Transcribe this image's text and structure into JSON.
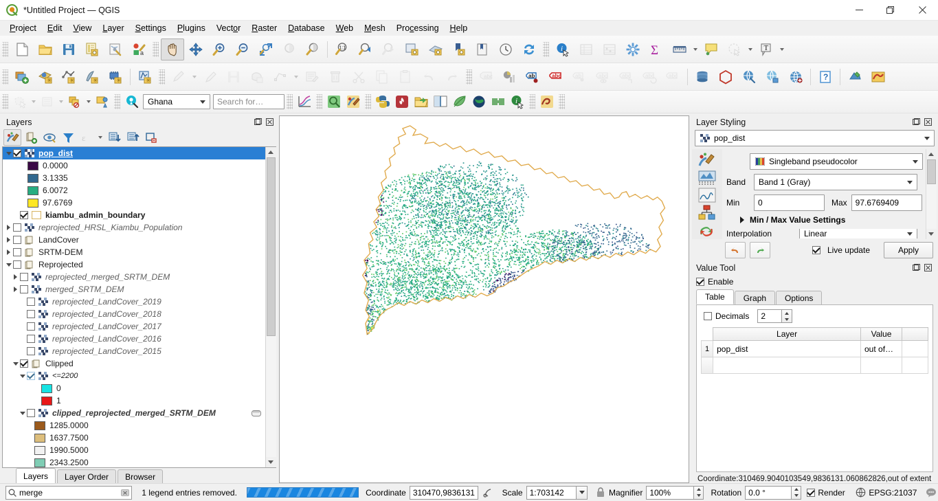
{
  "window": {
    "title": "*Untitled Project — QGIS",
    "app_icon": "qgis-logo-icon",
    "minimize_label": "—",
    "maximize_label": "❐",
    "close_label": "✕"
  },
  "menubar": {
    "items": [
      {
        "label": "Project",
        "accel": "P"
      },
      {
        "label": "Edit",
        "accel": "E"
      },
      {
        "label": "View",
        "accel": "V"
      },
      {
        "label": "Layer",
        "accel": "L"
      },
      {
        "label": "Settings",
        "accel": "S"
      },
      {
        "label": "Plugins",
        "accel": "P"
      },
      {
        "label": "Vector",
        "accel": "o"
      },
      {
        "label": "Raster",
        "accel": "R"
      },
      {
        "label": "Database",
        "accel": "D"
      },
      {
        "label": "Web",
        "accel": "W"
      },
      {
        "label": "Mesh",
        "accel": "M"
      },
      {
        "label": "Processing",
        "accel": "c"
      },
      {
        "label": "Help",
        "accel": "H"
      }
    ]
  },
  "toolbars": {
    "project": [
      {
        "name": "new-project-icon",
        "title": "New Project"
      },
      {
        "name": "open-project-icon",
        "title": "Open Project"
      },
      {
        "name": "save-project-icon",
        "title": "Save Project"
      },
      {
        "name": "save-project-as-icon",
        "title": "Save Project As"
      },
      {
        "name": "new-print-layout-icon",
        "title": "New Print Layout"
      },
      {
        "name": "style-manager-icon",
        "title": "Style Manager"
      }
    ],
    "navigation": [
      {
        "name": "pan-map-icon",
        "title": "Pan Map",
        "active": true
      },
      {
        "name": "pan-to-selection-icon",
        "title": "Pan Map to Selection"
      },
      {
        "name": "zoom-in-icon",
        "title": "Zoom In"
      },
      {
        "name": "zoom-out-icon",
        "title": "Zoom Out"
      },
      {
        "name": "zoom-full-icon",
        "title": "Zoom Full"
      },
      {
        "name": "zoom-to-selection-icon",
        "title": "Zoom To Selection",
        "dim": true
      },
      {
        "name": "zoom-to-layer-icon",
        "title": "Zoom To Layer"
      },
      {
        "name": "zoom-native-icon",
        "title": "Zoom To Native Resolution"
      },
      {
        "name": "zoom-last-icon",
        "title": "Zoom Last"
      },
      {
        "name": "zoom-next-icon",
        "title": "Zoom Next",
        "dim": true
      },
      {
        "name": "refresh-layer-icon",
        "title": "Refresh Layer"
      },
      {
        "name": "new-map-view-icon",
        "title": "New Map View"
      },
      {
        "name": "new-3d-map-view-icon",
        "title": "New 3D Map View"
      },
      {
        "name": "new-bookmark-icon",
        "title": "New Spatial Bookmark"
      },
      {
        "name": "show-bookmarks-icon",
        "title": "Show Bookmarks"
      },
      {
        "name": "temporal-controller-icon",
        "title": "Temporal Controller Panel"
      },
      {
        "name": "refresh-map-icon",
        "title": "Refresh"
      }
    ],
    "attributes": [
      {
        "name": "identify-features-icon",
        "title": "Identify Features"
      },
      {
        "name": "open-attribute-table-icon",
        "title": "Open Attribute Table",
        "dim": true
      },
      {
        "name": "field-calculator-icon",
        "title": "Field Calculator",
        "dim": true
      },
      {
        "name": "processing-toolbox-icon",
        "title": "Processing Toolbox"
      },
      {
        "name": "statistical-summary-icon",
        "title": "Statistical Summary"
      },
      {
        "name": "measure-line-icon",
        "title": "Measure Line"
      },
      {
        "name": "map-tips-icon",
        "title": "Show Map Tips"
      },
      {
        "name": "select-features-icon",
        "title": "Select Features",
        "dim": true
      },
      {
        "name": "text-annotation-icon",
        "title": "Text Annotation"
      }
    ],
    "data_source": [
      {
        "name": "add-layer-icon",
        "title": "Open Data Source Manager"
      },
      {
        "name": "add-vector-layer-icon",
        "title": "Add Vector Layer"
      },
      {
        "name": "add-raster-layer-icon",
        "title": "Add Raster Layer"
      },
      {
        "name": "add-delimited-text-icon",
        "title": "Add Delimited Text Layer"
      },
      {
        "name": "add-mesh-layer-icon",
        "title": "Add Mesh Layer"
      },
      {
        "name": "add-virtual-layer-icon",
        "title": "Add Virtual Layer"
      }
    ],
    "digitizing": [
      {
        "name": "current-edits-icon",
        "title": "Current Edits",
        "dim": true
      },
      {
        "name": "toggle-editing-icon",
        "title": "Toggle Editing",
        "dim": true
      },
      {
        "name": "save-layer-edits-icon",
        "title": "Save Layer Edits",
        "dim": true
      },
      {
        "name": "add-polygon-feature-icon",
        "title": "Add Polygon Feature",
        "dim": true
      },
      {
        "name": "vertex-tool-icon",
        "title": "Vertex Tool",
        "dim": true
      },
      {
        "name": "modify-attributes-icon",
        "title": "Modify Attributes of Features",
        "dim": true
      },
      {
        "name": "delete-selected-icon",
        "title": "Delete Selected",
        "dim": true
      },
      {
        "name": "cut-features-icon",
        "title": "Cut Features",
        "dim": true
      },
      {
        "name": "copy-features-icon",
        "title": "Copy Features",
        "dim": true
      },
      {
        "name": "paste-features-icon",
        "title": "Paste Features",
        "dim": true
      },
      {
        "name": "undo-icon",
        "title": "Undo",
        "dim": true
      },
      {
        "name": "redo-icon",
        "title": "Redo",
        "dim": true
      }
    ],
    "label": [
      {
        "name": "layer-labeling-icon",
        "title": "Layer Labeling Options",
        "dim": true
      },
      {
        "name": "layer-diagram-icon",
        "title": "Layer Diagram Options"
      },
      {
        "name": "highlight-pinned-labels-icon",
        "title": "Highlight Pinned Labels"
      },
      {
        "name": "toggle-unplaced-labels-icon",
        "title": "Toggle Display of Unplaced Labels"
      },
      {
        "name": "pin-labels-icon",
        "title": "Pin/Unpin Labels",
        "dim": true
      },
      {
        "name": "show-hide-labels-icon",
        "title": "Show/Hide Labels",
        "dim": true
      },
      {
        "name": "move-label-icon",
        "title": "Move Label",
        "dim": true
      },
      {
        "name": "rotate-label-icon",
        "title": "Rotate Label",
        "dim": true
      },
      {
        "name": "change-label-icon",
        "title": "Change Label",
        "dim": true
      }
    ],
    "database": [
      {
        "name": "db-manager-icon",
        "title": "DB Manager"
      },
      {
        "name": "geopackage-icon",
        "title": "Add GeoPackage Layer"
      },
      {
        "name": "metasearch-icon",
        "title": "MetaSearch"
      },
      {
        "name": "qgis-server-icon",
        "title": "QGIS Server"
      },
      {
        "name": "globe-icon",
        "title": "Globe"
      },
      {
        "name": "help-contents-icon",
        "title": "Help Contents"
      },
      {
        "name": "plugin-manager-icon",
        "title": "Plugin Manager"
      },
      {
        "name": "georeferencer-icon",
        "title": "Georeferencer"
      }
    ],
    "plugins_row3": [
      {
        "name": "select-features-by-area-icon",
        "title": "Select Features by Area",
        "dim": true
      },
      {
        "name": "deselect-features-icon",
        "title": "Deselect Features",
        "dim": true
      },
      {
        "name": "select-by-value-icon",
        "title": "Select Features by Value"
      },
      {
        "name": "select-by-location-icon",
        "title": "Select by Location"
      },
      {
        "name": "locator-search-icon",
        "title": "Locator Search"
      },
      {
        "name": "plot-icon",
        "title": "Data Plotly"
      },
      {
        "name": "value-tool-icon",
        "title": "Value Tool"
      },
      {
        "name": "paint-icon",
        "title": "Layer Styling"
      },
      {
        "name": "python-console-icon",
        "title": "Python Console"
      },
      {
        "name": "firebrand-icon",
        "title": "Plugin"
      },
      {
        "name": "open-folder-icon",
        "title": "Open Folder"
      },
      {
        "name": "split-view-icon",
        "title": "Split View"
      },
      {
        "name": "leaf-icon",
        "title": "Leaf Plugin"
      },
      {
        "name": "earth-icon",
        "title": "Earth Plugin"
      },
      {
        "name": "mesh-green-icon",
        "title": "Mesh Plugin"
      },
      {
        "name": "info-green-icon",
        "title": "Info Plugin"
      },
      {
        "name": "profile-tool-icon",
        "title": "Profile Tool"
      }
    ]
  },
  "search_toolbar": {
    "country_value": "Ghana",
    "search_placeholder": "Search for…"
  },
  "layers_panel": {
    "title": "Layers",
    "float_icon": "undock-icon",
    "close_icon": "close-icon",
    "toolbar": [
      {
        "name": "open-layer-styling-panel-icon",
        "title": "Open the Layer Styling panel",
        "pressed": true
      },
      {
        "name": "add-group-icon",
        "title": "Add Group"
      },
      {
        "name": "manage-layer-visibility-icon",
        "title": "Manage Map Themes"
      },
      {
        "name": "filter-legend-icon",
        "title": "Filter Legend by Map Content"
      },
      {
        "name": "filter-legend-expression-icon",
        "title": "Filter Legend by Expression",
        "dim": true
      },
      {
        "name": "expand-all-icon",
        "title": "Expand All"
      },
      {
        "name": "collapse-all-icon",
        "title": "Collapse All"
      },
      {
        "name": "remove-layer-icon",
        "title": "Remove Layer/Group"
      }
    ],
    "tree": [
      {
        "type": "layer",
        "indent": 0,
        "expander": "open",
        "checkbox": "on",
        "icon": "raster-layer-icon",
        "label": "pop_dist",
        "selected": true,
        "style": "sel"
      },
      {
        "type": "symbol",
        "indent": 2,
        "swatch": "#3b0a45",
        "label": "0.0000"
      },
      {
        "type": "symbol",
        "indent": 2,
        "swatch": "#31688e",
        "label": "3.1335"
      },
      {
        "type": "symbol",
        "indent": 2,
        "swatch": "#27ad81",
        "label": "6.0072"
      },
      {
        "type": "symbol",
        "indent": 2,
        "swatch": "#fde725",
        "label": "97.6769"
      },
      {
        "type": "layer",
        "indent": 1,
        "checkbox": "on",
        "icon": "vector-polygon-icon",
        "swatch": "#ffffff",
        "label": "kiambu_admin_boundary",
        "style": "bold"
      },
      {
        "type": "layer",
        "indent": 0,
        "expander": "closed",
        "checkbox": "off",
        "icon": "raster-layer-icon",
        "label": "reprojected_HRSL_Kiambu_Population",
        "style": "ital"
      },
      {
        "type": "group",
        "indent": 0,
        "expander": "closed",
        "checkbox": "off",
        "icon": "group-icon",
        "label": "LandCover"
      },
      {
        "type": "group",
        "indent": 0,
        "expander": "closed",
        "checkbox": "off",
        "icon": "group-icon",
        "label": "SRTM-DEM"
      },
      {
        "type": "group",
        "indent": 0,
        "expander": "open",
        "checkbox": "off",
        "icon": "group-icon",
        "label": "Reprojected"
      },
      {
        "type": "layer",
        "indent": 1,
        "expander": "closed",
        "checkbox": "off",
        "icon": "raster-layer-icon",
        "label": "reprojected_merged_SRTM_DEM",
        "style": "ital"
      },
      {
        "type": "layer",
        "indent": 1,
        "expander": "closed",
        "checkbox": "off",
        "icon": "raster-layer-icon",
        "label": "merged_SRTM_DEM",
        "style": "ital"
      },
      {
        "type": "layer",
        "indent": 2,
        "checkbox": "off",
        "icon": "raster-layer-icon",
        "label": "reprojected_LandCover_2019",
        "style": "ital"
      },
      {
        "type": "layer",
        "indent": 2,
        "checkbox": "off",
        "icon": "raster-layer-icon",
        "label": "reprojected_LandCover_2018",
        "style": "ital"
      },
      {
        "type": "layer",
        "indent": 2,
        "checkbox": "off",
        "icon": "raster-layer-icon",
        "label": "reprojected_LandCover_2017",
        "style": "ital"
      },
      {
        "type": "layer",
        "indent": 2,
        "checkbox": "off",
        "icon": "raster-layer-icon",
        "label": "reprojected_LandCover_2016",
        "style": "ital"
      },
      {
        "type": "layer",
        "indent": 2,
        "checkbox": "off",
        "icon": "raster-layer-icon",
        "label": "reprojected_LandCover_2015",
        "style": "ital"
      },
      {
        "type": "group",
        "indent": 1,
        "expander": "open",
        "checkbox": "on",
        "icon": "group-icon",
        "label": "Clipped"
      },
      {
        "type": "layer",
        "indent": 2,
        "expander": "open",
        "checkbox": "on-light",
        "icon": "raster-layer-icon",
        "label": "<=2200",
        "style": "ital-small"
      },
      {
        "type": "symbol",
        "indent": 4,
        "swatch": "#16e3e3",
        "label": "0"
      },
      {
        "type": "symbol",
        "indent": 4,
        "swatch": "#e81818",
        "label": "1"
      },
      {
        "type": "layer",
        "indent": 2,
        "expander": "open",
        "checkbox": "off",
        "icon": "raster-layer-icon",
        "label": "clipped_reprojected_merged_SRTM_DEM",
        "style": "ital-dark",
        "trailing_icon": "edit-palette-icon"
      },
      {
        "type": "symbol",
        "indent": 3,
        "swatch": "#9b5a1c",
        "label": "1285.0000"
      },
      {
        "type": "symbol",
        "indent": 3,
        "swatch": "#ddbe7c",
        "label": "1637.7500"
      },
      {
        "type": "symbol",
        "indent": 3,
        "swatch": "#f2f2f2",
        "label": "1990.5000"
      },
      {
        "type": "symbol",
        "indent": 3,
        "swatch": "#7fcdb4",
        "label": "2343.2500"
      }
    ],
    "tabs": [
      {
        "label": "Layers",
        "active": true
      },
      {
        "label": "Layer Order",
        "active": false
      },
      {
        "label": "Browser",
        "active": false
      }
    ]
  },
  "layer_styling": {
    "title": "Layer Styling",
    "float_icon": "undock-icon",
    "close_icon": "close-icon",
    "layer_selector": {
      "value": "pop_dist",
      "icon": "raster-layer-icon"
    },
    "side_tabs": [
      {
        "name": "symbology-tab-icon",
        "active": true
      },
      {
        "name": "transparency-tab-icon",
        "active": false
      },
      {
        "name": "histogram-tab-icon",
        "active": false
      },
      {
        "name": "rendering-tab-icon",
        "active": false
      },
      {
        "name": "history-tab-icon",
        "active": false
      }
    ],
    "render_type": {
      "label": "Singleband pseudocolor",
      "icon": "color-ramp-icon"
    },
    "band": {
      "label": "Band",
      "value": "Band 1 (Gray)"
    },
    "min": {
      "label": "Min",
      "value": "0"
    },
    "max": {
      "label": "Max",
      "value": "97.6769409"
    },
    "minmax_settings_label": "Min / Max Value Settings",
    "interpolation": {
      "label": "Interpolation",
      "value": "Linear"
    },
    "undo_icon": "undo-arrow-icon",
    "redo_icon": "redo-arrow-icon",
    "live_update": {
      "label": "Live update",
      "checked": true
    },
    "apply_label": "Apply"
  },
  "value_tool": {
    "title": "Value Tool",
    "float_icon": "undock-icon",
    "close_icon": "close-icon",
    "enable": {
      "label": "Enable",
      "checked": true
    },
    "tabs": [
      {
        "label": "Table",
        "active": true
      },
      {
        "label": "Graph",
        "active": false
      },
      {
        "label": "Options",
        "active": false
      }
    ],
    "decimals": {
      "label": "Decimals",
      "checked": false,
      "value": "2"
    },
    "table": {
      "columns": [
        "Layer",
        "Value"
      ],
      "rows": [
        {
          "num": "1",
          "layer": "pop_dist",
          "value": "out of…"
        }
      ]
    },
    "coordinate_readout": "Coordinate:310469.9040103549,9836131.060862826,out of extent"
  },
  "statusbar": {
    "locator": {
      "value": "merge",
      "icon": "search-icon",
      "clear_icon": "clear-icon"
    },
    "message": "1 legend entries removed.",
    "progress_percent": 100,
    "coordinate": {
      "label": "Coordinate",
      "value": "310470,9836131",
      "lock_icon": "extents-toggle-icon"
    },
    "scale": {
      "label": "Scale",
      "value": "1:703142"
    },
    "magnifier": {
      "label": "Magnifier",
      "value": "100%",
      "lock_icon": "lock-icon"
    },
    "rotation": {
      "label": "Rotation",
      "value": "0.0 °"
    },
    "render": {
      "label": "Render",
      "checked": true
    },
    "crs": {
      "label": "EPSG:21037",
      "icon": "crs-globe-icon"
    },
    "messages_icon": "messages-icon"
  },
  "map_canvas": {
    "boundary_color": "#e0a94a",
    "background": "#ffffff",
    "palette": [
      "#440154",
      "#3b528b",
      "#31688e",
      "#21918c",
      "#27ad81",
      "#5ec962",
      "#fde725"
    ]
  }
}
